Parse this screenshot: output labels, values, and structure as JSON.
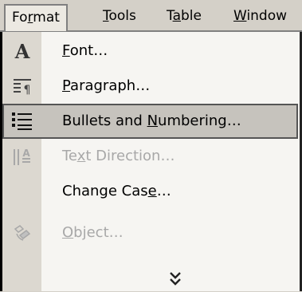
{
  "menubar": {
    "items": [
      {
        "pre": "Fo",
        "u": "r",
        "post": "mat",
        "active": true
      },
      {
        "pre": "",
        "u": "T",
        "post": "ools",
        "active": false
      },
      {
        "pre": "T",
        "u": "a",
        "post": "ble",
        "active": false
      },
      {
        "pre": "",
        "u": "W",
        "post": "indow",
        "active": false
      }
    ]
  },
  "menu": {
    "items": [
      {
        "pre": "",
        "u": "F",
        "post": "ont…",
        "icon": "font-icon",
        "disabled": false,
        "highlight": false
      },
      {
        "pre": "",
        "u": "P",
        "post": "aragraph…",
        "icon": "paragraph-icon",
        "disabled": false,
        "highlight": false
      },
      {
        "pre": "Bullets and ",
        "u": "N",
        "post": "umbering…",
        "icon": "bullets-numbering-icon",
        "disabled": false,
        "highlight": true
      },
      {
        "pre": "Te",
        "u": "x",
        "post": "t Direction…",
        "icon": "text-direction-icon",
        "disabled": true,
        "highlight": false
      },
      {
        "pre": "Change Cas",
        "u": "e",
        "post": "…",
        "icon": "",
        "disabled": false,
        "highlight": false
      },
      {
        "pre": "",
        "u": "O",
        "post": "bject…",
        "icon": "object-icon",
        "disabled": true,
        "highlight": false
      }
    ],
    "expand_icon": "double-chevron-down-icon"
  },
  "colors": {
    "menu_background": "#f6f5f2",
    "icon_column": "#dcd8d0",
    "highlight": "#c6c3bd",
    "disabled_text": "#a8a8a8"
  }
}
